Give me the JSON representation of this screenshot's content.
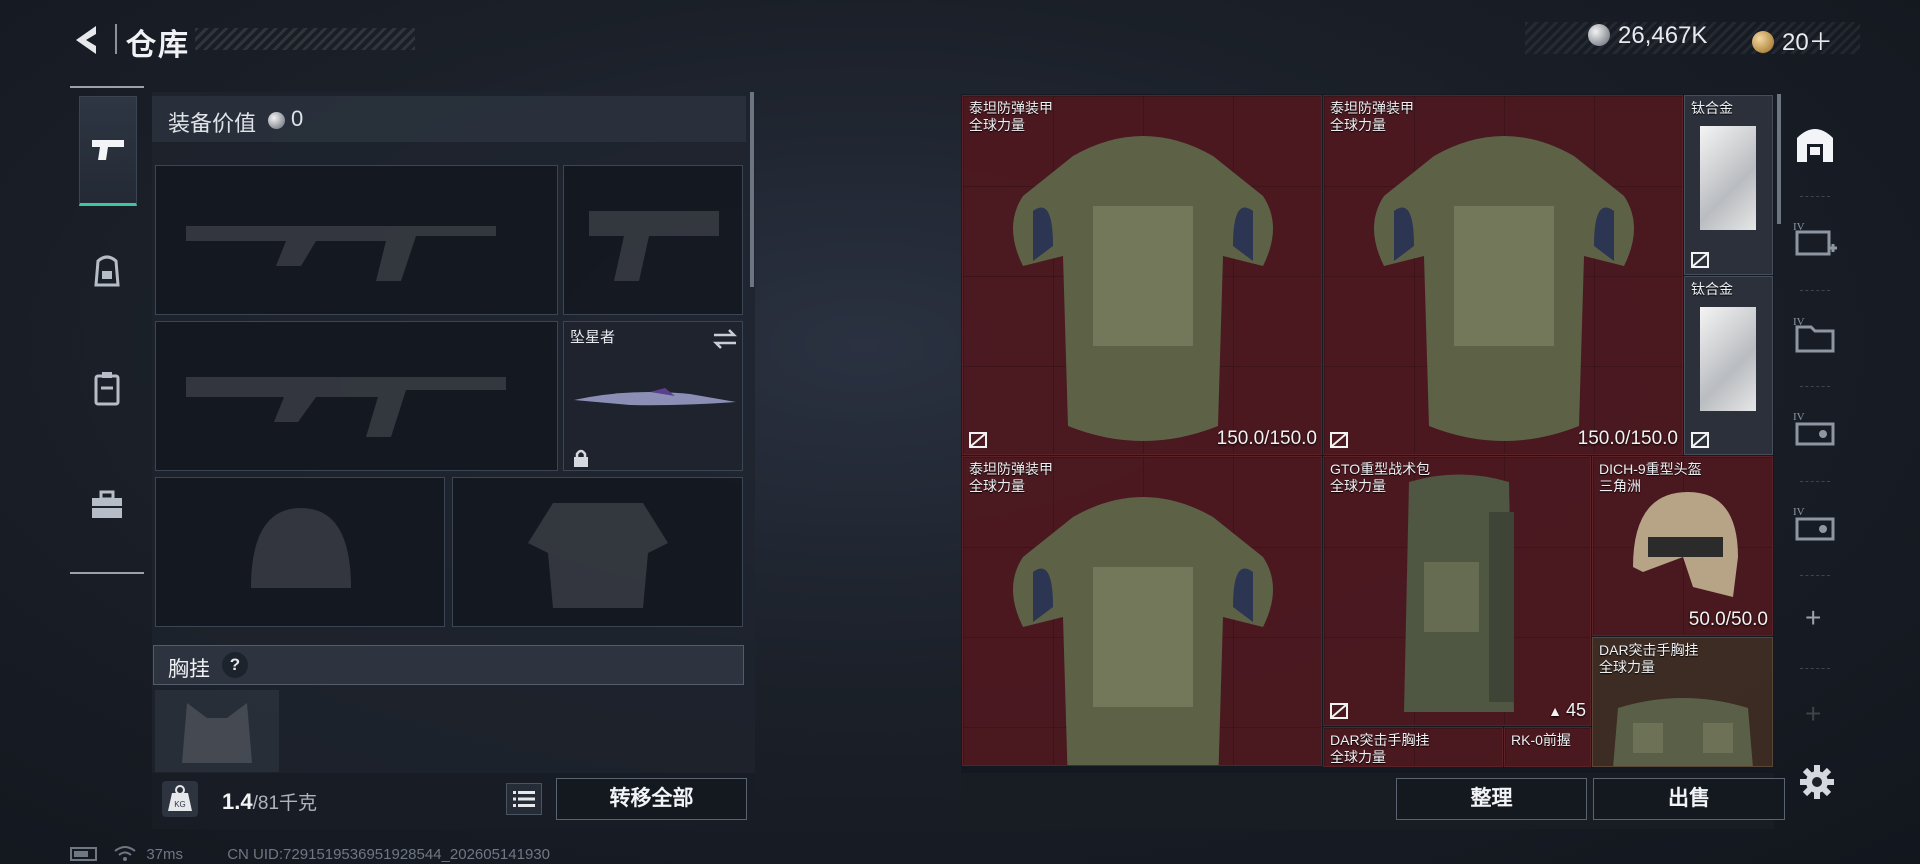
{
  "header": {
    "title": "仓库",
    "back_icon": "back-arrow-icon"
  },
  "currency": {
    "silver": "26,467K",
    "gold": "20＋"
  },
  "equipment": {
    "value_label": "装备价值",
    "value": "0",
    "special_slot_label": "坠星者",
    "chest_rig_label": "胸挂",
    "help": "?"
  },
  "weight": {
    "current": "1.4",
    "max": "/81千克"
  },
  "buttons": {
    "transfer_all": "转移全部",
    "organize": "整理",
    "sell": "出售"
  },
  "status": {
    "ping": "37ms",
    "uid": "CN UID:7291519536951928544_202605141930"
  },
  "storage": {
    "items": [
      {
        "name": "泰坦防弹装甲",
        "sub": "全球力量",
        "durability": "150.0/150.0"
      },
      {
        "name": "泰坦防弹装甲",
        "sub": "全球力量",
        "durability": "150.0/150.0"
      },
      {
        "name": "钛合金",
        "sub": ""
      },
      {
        "name": "钛合金",
        "sub": ""
      },
      {
        "name": "泰坦防弹装甲",
        "sub": "全球力量"
      },
      {
        "name": "GTO重型战术包",
        "sub": "全球力量",
        "count": "45"
      },
      {
        "name": "DICH-9重型头盔",
        "sub": "三角洲",
        "durability": "50.0/50.0"
      },
      {
        "name": "DAR突击手胸挂",
        "sub": "全球力量"
      },
      {
        "name": "DAR突击手胸挂",
        "sub": "全球力量"
      },
      {
        "name": "RK-0前握",
        "sub": ""
      }
    ]
  },
  "colors": {
    "accent": "#3fc6a0",
    "item_bg": "#6c181e"
  }
}
